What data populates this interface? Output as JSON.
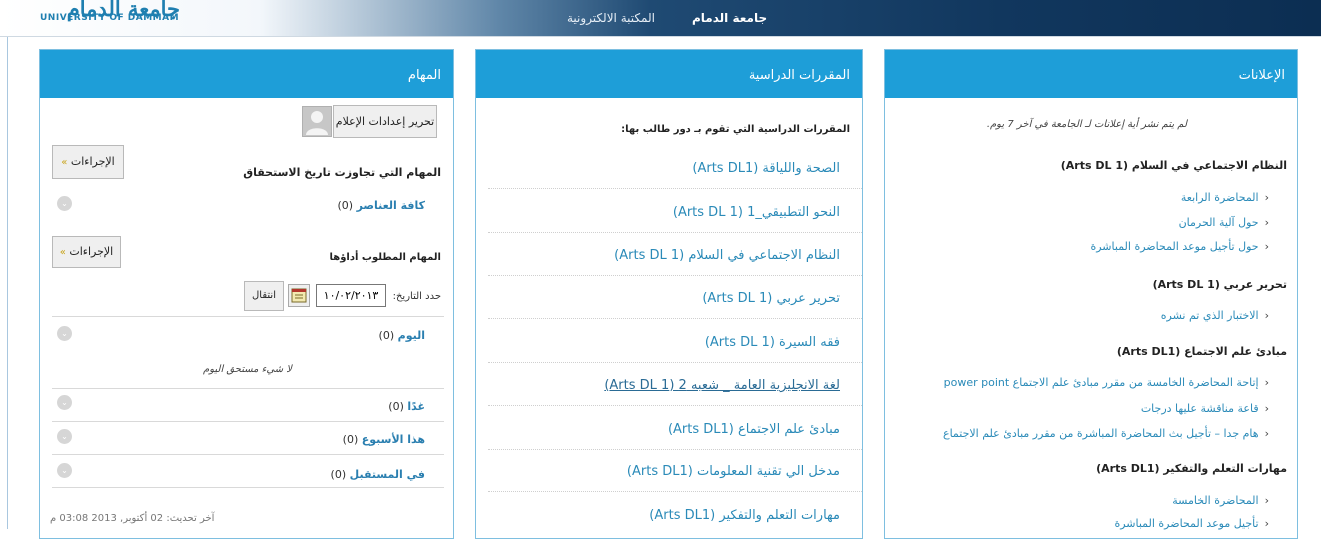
{
  "header": {
    "logo_ar": "جامعة الدمام",
    "logo_en": "UNIVERSITY OF DAMMAM",
    "nav": [
      {
        "label": "جامعة الدمام",
        "active": true
      },
      {
        "label": "المكتبة الالكترونية",
        "active": false
      }
    ]
  },
  "tasks": {
    "title": "المهام",
    "profile_button": "تحرير إعدادات الإعلام",
    "actions_label": "الإجراءات",
    "overdue_heading": "المهام التي تجاوزت تاريخ الاستحقاق",
    "all_items_label": "كافة العناصر",
    "all_items_count": "(0)",
    "due_heading": "المهام المطلوب أداؤها",
    "due_date_label": "حدد التاريخ:",
    "due_date_value": "١٠/٠٢/٢٠١٣",
    "go_button": "انتقال",
    "today_label": "اليوم",
    "today_count": "(0)",
    "nothing_due": "لا شيء مستحق اليوم",
    "tomorrow_label": "غدًا",
    "tomorrow_count": "(0)",
    "week_label": "هذا الأسبوع",
    "week_count": "(0)",
    "future_label": "في المستقبل",
    "future_count": "(0)",
    "last_updated": "آخر تحديث: 02 أكتوبر, 2013 03:08 م"
  },
  "courses": {
    "title": "المقررات الدراسية",
    "subtitle": "المقررات الدراسية التي تقوم بـ دور طالب بها:",
    "items": [
      "الصحة واللياقة (Arts DL1)",
      "النحو التطبيقي_1 (Arts DL 1)",
      "النظام الاجتماعي في السلام (Arts DL 1)",
      "تحرير عربي (Arts DL 1)",
      "فقه السيرة (Arts DL 1)",
      "لغة الانجليزية العامة _ شعبه 2 (Arts DL 1)",
      "مبادئ علم الاجتماع (Arts DL1)",
      "مدخل الي تقنية المعلومات (Arts DL1)",
      "مهارات التعلم والتفكير (Arts DL1)"
    ]
  },
  "announcements": {
    "title": "الإعلانات",
    "note": "لم يتم نشر أية إعلانات لـ الجامعة في آخر 7 يوم.",
    "groups": [
      {
        "heading": "النظام الاجتماعي في السلام (Arts DL 1)",
        "items": [
          "المحاضرة الرابعة",
          "حول آلية الحرمان",
          "حول تأجيل موعد المحاضرة المباشرة"
        ]
      },
      {
        "heading": "تحرير عربي (Arts DL 1)",
        "items": [
          "الاختبار الذي تم نشره"
        ]
      },
      {
        "heading": "مبادئ علم الاجتماع (Arts DL1)",
        "items": [
          "إتاحة المحاضرة الخامسة من مقرر مبادئ علم الاجتماع power point",
          "قاعة مناقشة عليها درجات",
          "هام جدا – تأجيل بث المحاضرة المباشرة من مقرر مبادئ علم الاجتماع"
        ]
      },
      {
        "heading": "مهارات التعلم والتفكير (Arts DL1)",
        "items": [
          "المحاضرة الخامسة",
          "تأجيل موعد المحاضرة المباشرة"
        ]
      }
    ]
  }
}
